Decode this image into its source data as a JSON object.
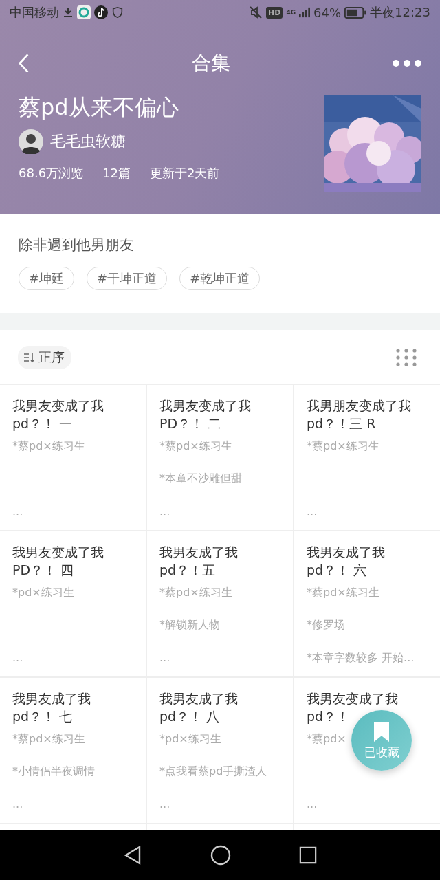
{
  "status_bar": {
    "carrier": "中国移动",
    "network_badge": "HD",
    "network": "4G",
    "battery": "64%",
    "time": "半夜12:23"
  },
  "header": {
    "title": "合集",
    "collection_title": "蔡pd从来不偏心",
    "author": "毛毛虫软糖",
    "stats": [
      "68.6万浏览",
      "12篇",
      "更新于2天前"
    ]
  },
  "intro": {
    "description": "除非遇到他男朋友",
    "tags": [
      "#坤廷",
      "#干坤正道",
      "#乾坤正道"
    ]
  },
  "sort": {
    "label": "正序"
  },
  "articles": [
    {
      "title": "我男友变成了我pd？！ 一",
      "tag": "*蔡pd×练习生",
      "more": "..."
    },
    {
      "title": "我男友变成了我PD？！ 二",
      "tag": "*蔡pd×练习生",
      "note": "*本章不沙雕但甜",
      "more": "..."
    },
    {
      "title": "我男朋友变成了我pd？！三 R",
      "tag": " *蔡pd×练习生",
      "more": "..."
    },
    {
      "title": "我男友变成了我PD？！ 四",
      "tag": "*pd×练习生",
      "more": "..."
    },
    {
      "title": "我男友成了我pd？！五",
      "tag": "*蔡pd×练习生",
      "note": "*解锁新人物",
      "more": "..."
    },
    {
      "title": "我男友成了我pd？！ 六",
      "tag": "*蔡pd×练习生",
      "note": "*修罗场",
      "more": "*本章字数较多 开始..."
    },
    {
      "title": "我男友成了我pd？！ 七",
      "tag": "*蔡pd×练习生",
      "note": "*小情侣半夜调情",
      "more": "..."
    },
    {
      "title": "我男友成了我pd？！ 八",
      "tag": "*pd×练习生",
      "note": "*点我看蔡pd手撕渣人",
      "more": "..."
    },
    {
      "title": "我男友变成了我pd？！",
      "tag": "*蔡pd×",
      "more": "..."
    }
  ],
  "favorite_button": {
    "label": "已收藏",
    "saved": true
  }
}
